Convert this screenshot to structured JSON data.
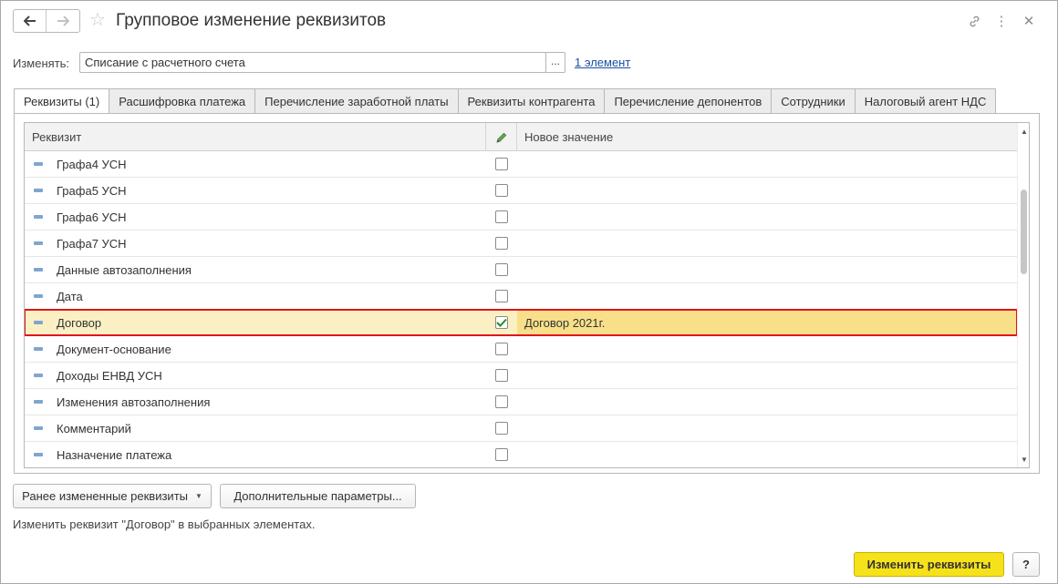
{
  "window": {
    "title": "Групповое изменение реквизитов",
    "nav": {
      "back": "🡐",
      "forward": "🡒"
    },
    "icons": {
      "star": "☆",
      "link": "🔗",
      "more": "⋮",
      "close": "✕"
    }
  },
  "change": {
    "label": "Изменять:",
    "value": "Списание с расчетного счета",
    "pick": "...",
    "link": "1 элемент"
  },
  "tabs": [
    {
      "label": "Реквизиты (1)",
      "active": true
    },
    {
      "label": "Расшифровка платежа"
    },
    {
      "label": "Перечисление заработной платы"
    },
    {
      "label": "Реквизиты контрагента"
    },
    {
      "label": "Перечисление депонентов"
    },
    {
      "label": "Сотрудники"
    },
    {
      "label": "Налоговый агент НДС"
    }
  ],
  "grid": {
    "columns": {
      "requisite": "Реквизит",
      "flag_icon": "pencil-icon",
      "new_value": "Новое значение"
    },
    "rows": [
      {
        "name": "Графа4 УСН",
        "checked": false,
        "value": ""
      },
      {
        "name": "Графа5 УСН",
        "checked": false,
        "value": ""
      },
      {
        "name": "Графа6 УСН",
        "checked": false,
        "value": ""
      },
      {
        "name": "Графа7 УСН",
        "checked": false,
        "value": ""
      },
      {
        "name": "Данные автозаполнения",
        "checked": false,
        "value": ""
      },
      {
        "name": "Дата",
        "checked": false,
        "value": ""
      },
      {
        "name": "Договор",
        "checked": true,
        "value": "Договор 2021г.",
        "selected": true
      },
      {
        "name": "Документ-основание",
        "checked": false,
        "value": ""
      },
      {
        "name": "Доходы ЕНВД УСН",
        "checked": false,
        "value": ""
      },
      {
        "name": "Изменения автозаполнения",
        "checked": false,
        "value": ""
      },
      {
        "name": "Комментарий",
        "checked": false,
        "value": ""
      },
      {
        "name": "Назначение платежа",
        "checked": false,
        "value": ""
      }
    ]
  },
  "buttons": {
    "previously_changed": "Ранее измененные реквизиты",
    "additional_params": "Дополнительные параметры...",
    "apply": "Изменить реквизиты",
    "help": "?"
  },
  "hint": "Изменить реквизит \"Договор\" в выбранных элементах.",
  "colors": {
    "selection_frame": "#e1141c",
    "selected_row": "#fbf0c4",
    "primary_button": "#f6e21a",
    "check": "#2b8a2b"
  }
}
